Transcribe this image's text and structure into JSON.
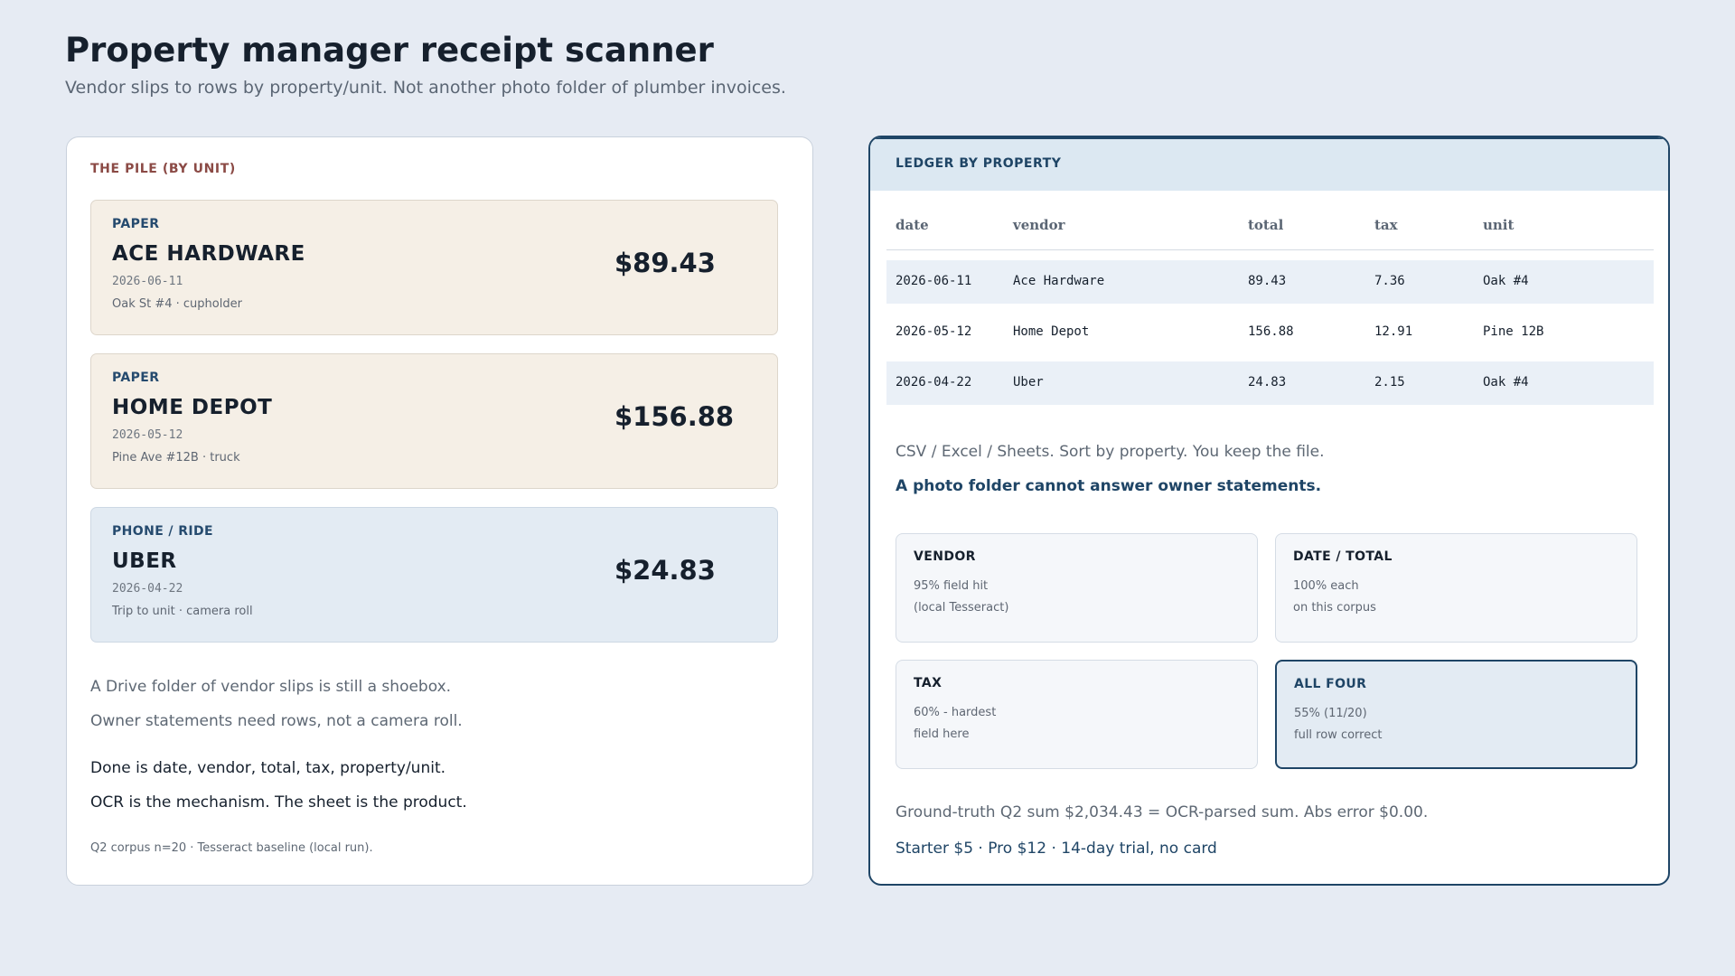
{
  "header": {
    "title": "Property manager receipt scanner",
    "subtitle": "Vendor slips to rows by property/unit. Not another photo folder of plumber invoices."
  },
  "pile": {
    "label": "THE PILE (BY UNIT)",
    "slips": [
      {
        "kind": "PAPER",
        "vendor": "ACE HARDWARE",
        "date": "2026-06-11",
        "note": "Oak St #4 · cupholder",
        "amount": "$89.43"
      },
      {
        "kind": "PAPER",
        "vendor": "HOME DEPOT",
        "date": "2026-05-12",
        "note": "Pine Ave #12B · truck",
        "amount": "$156.88"
      },
      {
        "kind": "PHONE / RIDE",
        "vendor": "UBER",
        "date": "2026-04-22",
        "note": "Trip to unit · camera roll",
        "amount": "$24.83"
      }
    ],
    "text1": "A Drive folder of vendor slips is still a shoebox.",
    "text2": "Owner statements need rows, not a camera roll.",
    "text3": "Done is date, vendor, total, tax, property/unit.",
    "text4": "OCR is the mechanism. The sheet is the product.",
    "footnote": "Q2 corpus n=20 · Tesseract baseline (local run)."
  },
  "ledger": {
    "title": "LEDGER BY PROPERTY",
    "columns": [
      "date",
      "vendor",
      "total",
      "tax",
      "unit"
    ],
    "rows": [
      [
        "2026-06-11",
        "Ace Hardware",
        "89.43",
        "7.36",
        "Oak #4"
      ],
      [
        "2026-05-12",
        "Home Depot",
        "156.88",
        "12.91",
        "Pine 12B"
      ],
      [
        "2026-04-22",
        "Uber",
        "24.83",
        "2.15",
        "Oak #4"
      ]
    ],
    "export_line": "CSV / Excel / Sheets. Sort by property. You keep the file.",
    "strong_line": "A photo folder cannot answer owner statements.",
    "metrics": [
      {
        "title": "VENDOR",
        "line1": "95% field hit",
        "line2": "(local Tesseract)"
      },
      {
        "title": "DATE / TOTAL",
        "line1": "100% each",
        "line2": "on this corpus"
      },
      {
        "title": "TAX",
        "line1": "60% - hardest",
        "line2": "field here"
      },
      {
        "title": "ALL FOUR",
        "line1": "55% (11/20)",
        "line2": "full row correct"
      }
    ],
    "truth_line": "Ground-truth Q2 sum $2,034.43 = OCR-parsed sum. Abs error $0.00.",
    "pricing_line": "Starter $5 · Pro $12 · 14-day trial, no card"
  }
}
